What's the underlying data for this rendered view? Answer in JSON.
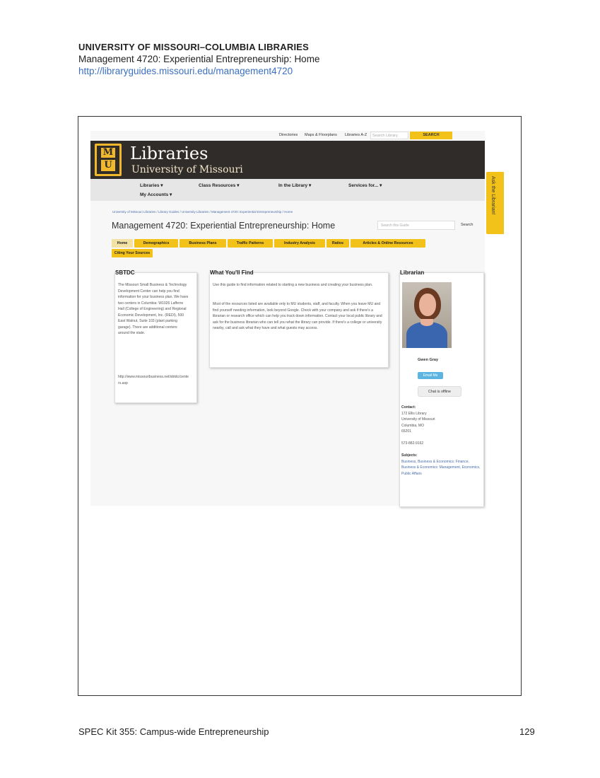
{
  "doc": {
    "institution": "UNIVERSITY OF MISSOURI–COLUMBIA LIBRARIES",
    "guide_title": "Management 4720: Experiential Entrepreneurship: Home",
    "url": "http://libraryguides.missouri.edu/management4720"
  },
  "site": {
    "util": {
      "directories": "Directories",
      "maps": "Maps & Floorplans",
      "az": "Libraries A-Z",
      "search_placeholder": "Search Library",
      "search_btn": "SEARCH"
    },
    "brand": {
      "libraries": "Libraries",
      "university": "University of Missouri"
    },
    "nav": {
      "libraries": "Libraries ▾",
      "class_resources": "Class Resources ▾",
      "in_library": "In the Library ▾",
      "services": "Services for... ▾",
      "my_accounts": "My Accounts ▾"
    },
    "ask_tab": "Ask the Librarian!",
    "breadcrumbs": "University of Missouri Libraries  /  Library Guides  /  University Libraries  /  Management 4720: Experiential Entrepreneurship  /  Home",
    "page_title": "Management 4720: Experiential Entrepreneurship: Home",
    "guide_search_placeholder": "Search this Guide",
    "guide_search_btn": "Search",
    "tabs": [
      "Home",
      "Demographics",
      "Business Plans",
      "Traffic Patterns",
      "Industry Analysis",
      "Ratios",
      "Articles & Online Resources",
      "Citing Your Sources"
    ],
    "sbtdc": {
      "title": "SBTDC",
      "body": "The Missouri Small Business & Technology Development Center can help you find information for your business plan. We have two centers in Columbia: W1026 Lafferre Hall (College of Engineering) and Regional Economic Development, Inc. (REDI), 500 East Walnut, Suite 103 (plant parking garage). There are additional centers around the state.",
      "link": "http://www.missouribusiness.net/sbtdc/centers.asp"
    },
    "find": {
      "title": "What You'll Find",
      "p1": "Use this guide to find information related to starting a new business and creating your business plan.",
      "p2": "Most of the resources listed are available only to MU students, staff, and faculty. When you leave MU and find yourself needing information, look beyond Google. Check with your company and ask if there's a librarian or research office which can help you track down information. Contact your local public library and ask for the business librarian who can tell you what the library can provide. If there's a college or university nearby, call and ask what they have and what guests may access."
    },
    "librarian": {
      "title": "Librarian",
      "name": "Gwen Gray",
      "email_btn": "Email Me",
      "chat": "Chat is offline",
      "contact_label": "Contact:",
      "contact": [
        "172 Ellis Library",
        "University of Missouri",
        "Columbia, MO",
        "65201"
      ],
      "phone": "573-882-9162",
      "subjects_label": "Subjects:",
      "subjects": "Business, Business & Economics: Finance, Business & Economics: Management, Economics, Public Affairs"
    }
  },
  "footer": {
    "left": "SPEC Kit 355: Campus-wide Entrepreneurship",
    "page": "129"
  },
  "colors": {
    "brand_gold": "#f1b82d",
    "banner": "#302c29",
    "tab": "#f3c21a",
    "link": "#4a6ea9"
  }
}
